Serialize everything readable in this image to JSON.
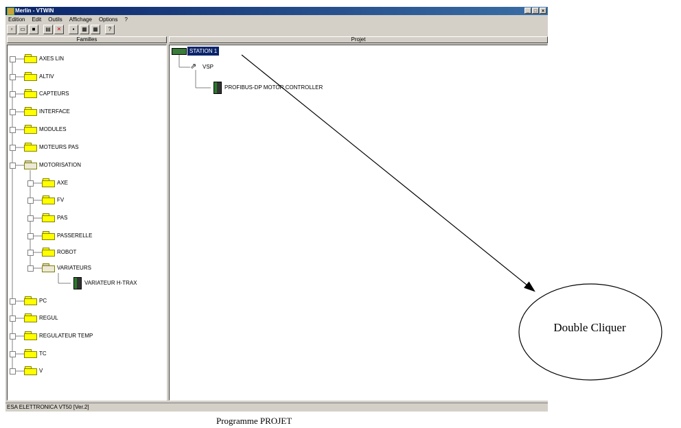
{
  "window": {
    "title": "Merlin - VTWIN",
    "controls": [
      "_",
      "□",
      "×"
    ]
  },
  "menu": [
    "Edition",
    "Edit",
    "Outils",
    "Affichage",
    "Options",
    "?"
  ],
  "toolbar": [
    "new",
    "open",
    "save",
    "print",
    "delete",
    "floppy",
    "view1",
    "view2",
    "help"
  ],
  "panes": {
    "left_header": "Familles",
    "right_header": "Projet"
  },
  "tree_left": [
    {
      "label": "AXES LIN",
      "level": 0,
      "open": false
    },
    {
      "label": "ALTIV",
      "level": 0,
      "open": false
    },
    {
      "label": "CAPTEURS",
      "level": 0,
      "open": false
    },
    {
      "label": "INTERFACE",
      "level": 0,
      "open": false
    },
    {
      "label": "MODULES",
      "level": 0,
      "open": false
    },
    {
      "label": "MOTEURS PAS",
      "level": 0,
      "open": false
    },
    {
      "label": "MOTORISATION",
      "level": 0,
      "open": true
    },
    {
      "label": "AXE",
      "level": 1,
      "open": false
    },
    {
      "label": "FV",
      "level": 1,
      "open": false
    },
    {
      "label": "PAS",
      "level": 1,
      "open": false
    },
    {
      "label": "PASSERELLE",
      "level": 1,
      "open": false
    },
    {
      "label": "ROBOT",
      "level": 1,
      "open": false
    },
    {
      "label": "VARIATEURS",
      "level": 1,
      "open": true
    },
    {
      "label": "VARIATEUR H-TRAX",
      "level": 2,
      "module": true
    },
    {
      "label": "PC",
      "level": 0,
      "open": false
    },
    {
      "label": "REGUL",
      "level": 0,
      "open": false
    },
    {
      "label": "REGULATEUR TEMP",
      "level": 0,
      "open": false
    },
    {
      "label": "TC",
      "level": 0,
      "open": false
    },
    {
      "label": "V",
      "level": 0,
      "open": false
    }
  ],
  "tree_right": {
    "root": "STATION 1",
    "link": "VSP",
    "device": "PROFIBUS-DP MOTOR CONTROLLER"
  },
  "status": "ESA ELETTRONICA VT50 [Ver.2]",
  "annotation": {
    "callout": "Double Cliquer",
    "caption": "Programme PROJET"
  }
}
